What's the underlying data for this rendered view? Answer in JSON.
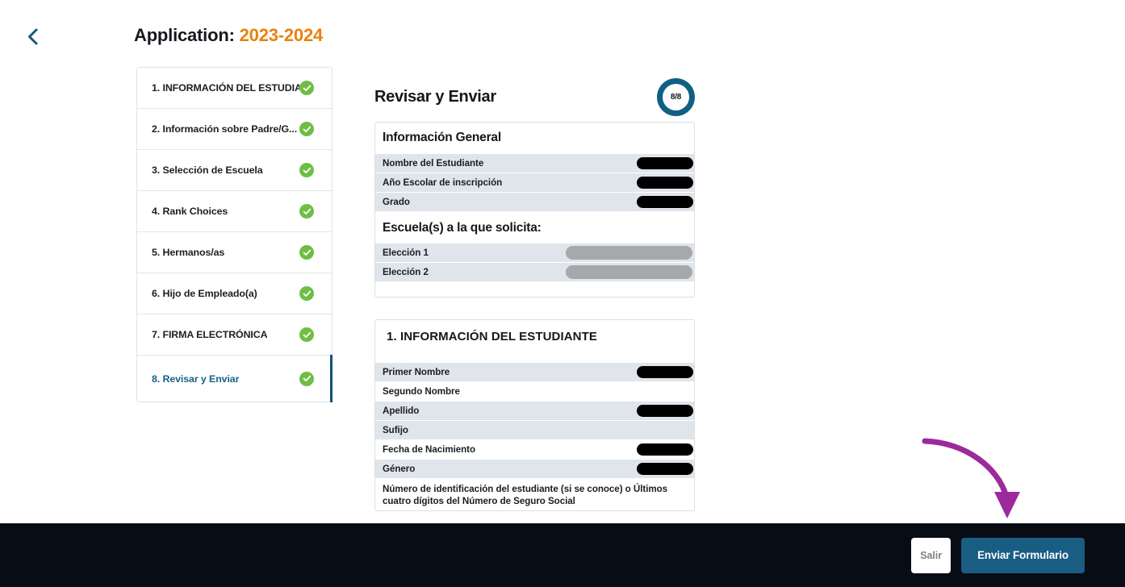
{
  "header": {
    "back_icon": "chevron-left-icon",
    "title_prefix": "Application:",
    "title_year": "2023-2024"
  },
  "colors": {
    "accent_orange": "#e8820c",
    "accent_teal": "#0f5275",
    "check_green": "#6ebe44",
    "bottom_bar": "#070c15",
    "submit_button": "#1a5d83",
    "annotation_purple": "#9c2a9c",
    "row_shade": "#dfe5eb"
  },
  "sidebar": {
    "steps": [
      {
        "label": "1. INFORMACIÓN DEL ESTUDIA...",
        "complete": true,
        "active": false
      },
      {
        "label": "2. Información sobre Padre/G...",
        "complete": true,
        "active": false
      },
      {
        "label": "3. Selección de Escuela",
        "complete": true,
        "active": false
      },
      {
        "label": "4. Rank Choices",
        "complete": true,
        "active": false
      },
      {
        "label": "5. Hermanos/as",
        "complete": true,
        "active": false
      },
      {
        "label": "6. Hijo de Empleado(a)",
        "complete": true,
        "active": false
      },
      {
        "label": "7. FIRMA ELECTRÓNICA",
        "complete": true,
        "active": false
      },
      {
        "label": "8. Revisar y Enviar",
        "complete": true,
        "active": true
      }
    ]
  },
  "main": {
    "title": "Revisar y Enviar",
    "progress": "8/8",
    "cards": [
      {
        "heading": "Información General",
        "rows": [
          {
            "label": "Nombre del Estudiante",
            "redaction": "black",
            "shaded": true
          },
          {
            "label": "Año Escolar de inscripción",
            "redaction": "black",
            "shaded": true
          },
          {
            "label": "Grado",
            "redaction": "black",
            "shaded": true
          }
        ],
        "subheading": "Escuela(s) a la que solicita:",
        "subrows": [
          {
            "label": "Elección 1",
            "redaction": "gray",
            "shaded": true
          },
          {
            "label": "Elección 2",
            "redaction": "gray",
            "shaded": true
          }
        ]
      },
      {
        "heading": "1. INFORMACIÓN DEL ESTUDIANTE",
        "rows": [
          {
            "label": "Primer Nombre",
            "redaction": "black",
            "shaded": true
          },
          {
            "label": "Segundo Nombre",
            "redaction": "none",
            "shaded": false
          },
          {
            "label": "Apellido",
            "redaction": "black",
            "shaded": true
          },
          {
            "label": "Sufijo",
            "redaction": "none",
            "shaded": true
          },
          {
            "label": "Fecha de Nacimiento",
            "redaction": "black",
            "shaded": false
          },
          {
            "label": "Género",
            "redaction": "black",
            "shaded": true
          },
          {
            "label": "Número de identificación del estudiante (si se conoce) o Últimos cuatro dígitos del Número de Seguro Social",
            "redaction": "none",
            "shaded": false,
            "tall": true
          }
        ]
      }
    ]
  },
  "footer": {
    "exit_label": "Salir",
    "submit_label": "Enviar Formulario"
  },
  "annotation": {
    "type": "curved-arrow",
    "points_to": "submit-form-button"
  }
}
